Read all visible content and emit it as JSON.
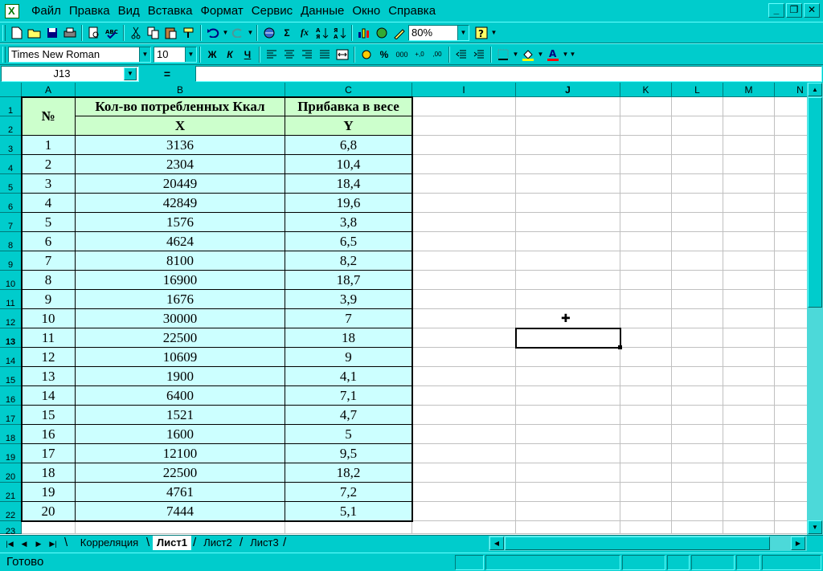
{
  "menu": [
    "Файл",
    "Правка",
    "Вид",
    "Вставка",
    "Формат",
    "Сервис",
    "Данные",
    "Окно",
    "Справка"
  ],
  "window_buttons": {
    "minimize": "_",
    "restore": "❐",
    "close": "✕"
  },
  "toolbar": {
    "zoom": "80%",
    "font_name": "Times New Roman",
    "font_size": "10",
    "bold": "Ж",
    "italic": "К",
    "underline": "Ч",
    "sum": "Σ",
    "fx": "fx",
    "percent": "%",
    "thousands": "000"
  },
  "name_box": "J13",
  "formula_eq": "=",
  "columns": [
    "A",
    "B",
    "C",
    "I",
    "J",
    "K",
    "L",
    "M",
    "N"
  ],
  "rows": [
    "1",
    "2",
    "3",
    "4",
    "5",
    "6",
    "7",
    "8",
    "9",
    "10",
    "11",
    "12",
    "13",
    "14",
    "15",
    "16",
    "17",
    "18",
    "19",
    "20",
    "21",
    "22",
    "23"
  ],
  "table": {
    "header": {
      "num": "№",
      "kcal": "Кол-во потребленных Ккал",
      "weight": "Прибавка в весе",
      "x": "X",
      "y": "Y"
    },
    "data": [
      [
        "1",
        "3136",
        "6,8"
      ],
      [
        "2",
        "2304",
        "10,4"
      ],
      [
        "3",
        "20449",
        "18,4"
      ],
      [
        "4",
        "42849",
        "19,6"
      ],
      [
        "5",
        "1576",
        "3,8"
      ],
      [
        "6",
        "4624",
        "6,5"
      ],
      [
        "7",
        "8100",
        "8,2"
      ],
      [
        "8",
        "16900",
        "18,7"
      ],
      [
        "9",
        "1676",
        "3,9"
      ],
      [
        "10",
        "30000",
        "7"
      ],
      [
        "11",
        "22500",
        "18"
      ],
      [
        "12",
        "10609",
        "9"
      ],
      [
        "13",
        "1900",
        "4,1"
      ],
      [
        "14",
        "6400",
        "7,1"
      ],
      [
        "15",
        "1521",
        "4,7"
      ],
      [
        "16",
        "1600",
        "5"
      ],
      [
        "17",
        "12100",
        "9,5"
      ],
      [
        "18",
        "22500",
        "18,2"
      ],
      [
        "19",
        "4761",
        "7,2"
      ],
      [
        "20",
        "7444",
        "5,1"
      ]
    ]
  },
  "sheets": [
    "Корреляция",
    "Лист1",
    "Лист2",
    "Лист3"
  ],
  "active_sheet": "Лист1",
  "status": "Готово",
  "colors": {
    "app_bg": "#00CCCC",
    "table_fill": "#CCFFFF",
    "header_fill": "#CCFFCC"
  }
}
